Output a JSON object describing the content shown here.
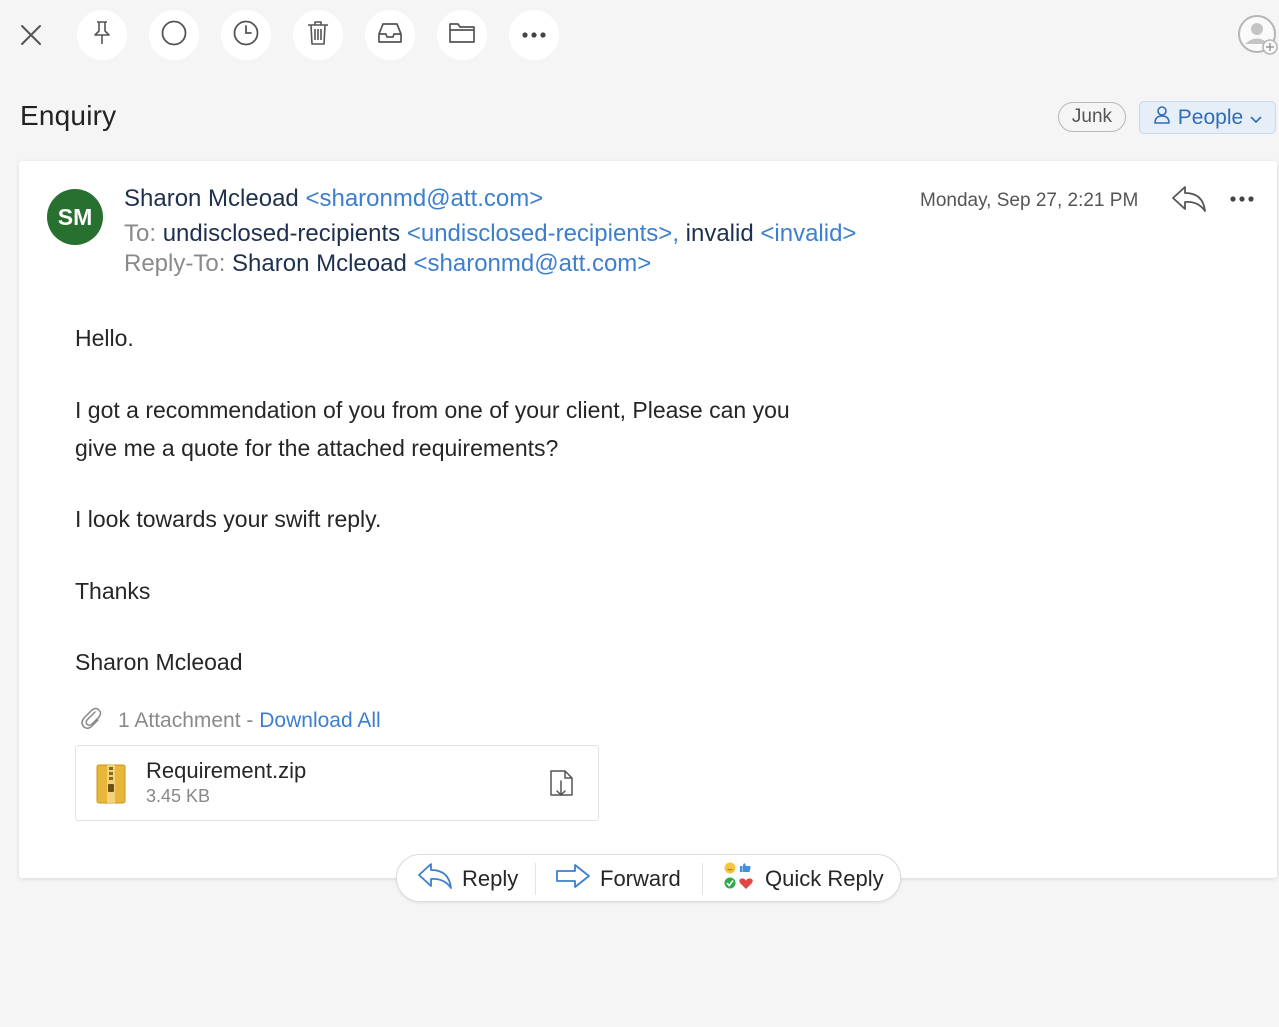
{
  "toolbar": {
    "icons": [
      "close-icon",
      "pin-icon",
      "circle-icon",
      "clock-icon",
      "trash-icon",
      "inbox-icon",
      "folder-icon",
      "more-icon",
      "add-contact-icon"
    ]
  },
  "subject": "Enquiry",
  "tags": {
    "junk": "Junk",
    "people": "People"
  },
  "email": {
    "avatar_initials": "SM",
    "avatar_color": "#27702f",
    "from_name": "Sharon Mcleoad",
    "from_addr": "<sharonmd@att.com>",
    "to_label": "To:",
    "to_name1": "undisclosed-recipients",
    "to_addr1": "<undisclosed-recipients>,",
    "to_name2": "invalid",
    "to_addr2": "<invalid>",
    "replyto_label": "Reply-To:",
    "replyto_name": "Sharon Mcleoad",
    "replyto_addr": "<sharonmd@att.com>",
    "date": "Monday, Sep 27, 2:21 PM",
    "body": {
      "greeting": "Hello.",
      "para1_line1": "I got a recommendation of you from one of your client, Please can you",
      "para1_line2": "give me a quote for the attached requirements?",
      "para2": "I look towards your swift reply.",
      "thanks": "Thanks",
      "signature": "Sharon Mcleoad"
    }
  },
  "attachments": {
    "count_label": "1 Attachment -",
    "download_all": "Download All",
    "file_name": "Requirement.zip",
    "file_size": "3.45 KB"
  },
  "actions": {
    "reply": "Reply",
    "forward": "Forward",
    "quick_reply": "Quick Reply"
  },
  "colors": {
    "link": "#3d7fcf",
    "accent": "#2f6db5"
  }
}
